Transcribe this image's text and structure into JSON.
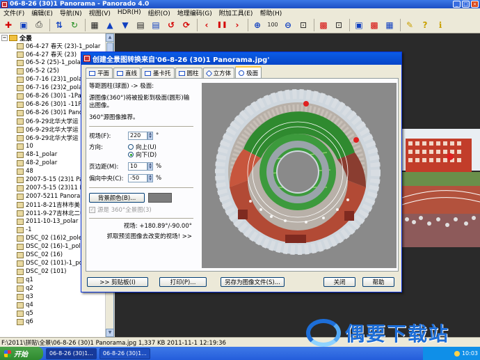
{
  "window": {
    "title": "06-8-26 (30)1 Panorama - Panorado 4.0",
    "controls": [
      "_",
      "□",
      "×"
    ]
  },
  "menu": [
    "文件(F)",
    "编辑(E)",
    "导航(N)",
    "视图(V)",
    "HDR(H)",
    "组织(O)",
    "地理编码(G)",
    "附加工具(E)",
    "帮助(H)"
  ],
  "toolbar": {
    "icons": [
      "new-icon",
      "open-icon",
      "print-icon",
      "sort-icon",
      "refresh-icon",
      "up-icon",
      "down-icon",
      "image-icon",
      "save-icon",
      "rotate-icon",
      "reload-icon",
      "prev-icon",
      "pause-icon",
      "next-icon",
      "zoom-in-icon",
      "zoom-100-icon",
      "zoom-out-icon",
      "fit-icon",
      "projection-icon",
      "tools-icon",
      "help-icon",
      "info-icon"
    ],
    "glyphs": [
      "✚",
      "▣",
      "⎙",
      "⇅",
      "↻",
      "▲",
      "▼",
      "▦",
      "▤",
      "↺",
      "⟳",
      "‹",
      "❚❚",
      "›",
      "⊕",
      "100",
      "⊖",
      "⊡",
      "▩",
      "✎",
      "?",
      "ℹ"
    ],
    "zoom_label": "100"
  },
  "tree": {
    "root_label": "全景",
    "items": [
      "06-4-27 春天 (23)-1_polar",
      "06-4-27 春天 (23)",
      "06-5-2 (25)-1_polar",
      "06-5-2 (25)",
      "06-7-16 (23)1_polar",
      "06-7-16 (23)2_polar",
      "06-8-26 (30)1 -1Pan",
      "06-8-26 (30)1 -11Pa",
      "06-8-26 (30)1 Panor",
      "06-9-29北华大学运",
      "06-9-29北华大学运",
      "06-9-29北华大学运",
      "10",
      "48-1_polar",
      "48-2_polar",
      "48",
      "2007-5-15 (23)1 Par",
      "2007-5-15 (23)11 Pa",
      "2007-5211 Panoram",
      "2011-8-21吉林市美",
      "2011-9-27吉林北二中",
      "2011-10-13_polar",
      "-1",
      "DSC_02 (16)2_pole",
      "DSC_02 (16)-1_pola",
      "DSC_02 (16)",
      "DSC_02 (101)-1_por",
      "DSC_02 (101)",
      "q1",
      "q2",
      "q3",
      "q4",
      "q5",
      "q6"
    ]
  },
  "status": {
    "text": "F:\\2011\\拼贴\\全景\\06-8-26 (30)1 Panorama.jpg  1,337 KB  2011-11-1 12:19:36"
  },
  "taskbar": {
    "start": "开始",
    "tasks": [
      "06-8-26 (30)1...",
      "06-8-26 (30)1..."
    ],
    "clock": "10:03"
  },
  "watermark": {
    "text": "偶要下载站"
  },
  "dialog": {
    "title": "创建全景图转换来自'06-8-26 (30)1 Panorama.jpg'",
    "tabs": [
      "平面",
      "直线",
      "墨卡托",
      "圆柱",
      "立方体",
      "极面"
    ],
    "active_tab": 5,
    "heading": "等距圆柱(球面) -> 极面:",
    "description": "源图像(360°)将被投影到极面(圆形)输出图像。",
    "recommend": "360°源图像推荐。",
    "fov_label": "视场(F):",
    "fov_value": "220",
    "fov_unit": "°",
    "direction_label": "方向:",
    "direction_up": "向上(U)",
    "direction_down": "向下(D)",
    "direction_selected": "down",
    "margin_label": "页边距(M):",
    "margin_value": "10",
    "offset_label": "偏向中央(C):",
    "offset_value": "-50",
    "percent_unit": "%",
    "bg_color_button": "背景颜色(B)...",
    "bg_color": "#7d7d7d",
    "checkbox_label": "源是 360°全景图(3)",
    "fov_readout": "视场: +180.89°/-90.00°",
    "capture_text": "抓取预览图像去改变的视场!  >>",
    "buttons": {
      "clipboard": ">> 剪贴板(I)",
      "print": "打印(P)...",
      "save": "另存为图像文件(S)...",
      "close": "关闭",
      "help": "帮助"
    }
  }
}
